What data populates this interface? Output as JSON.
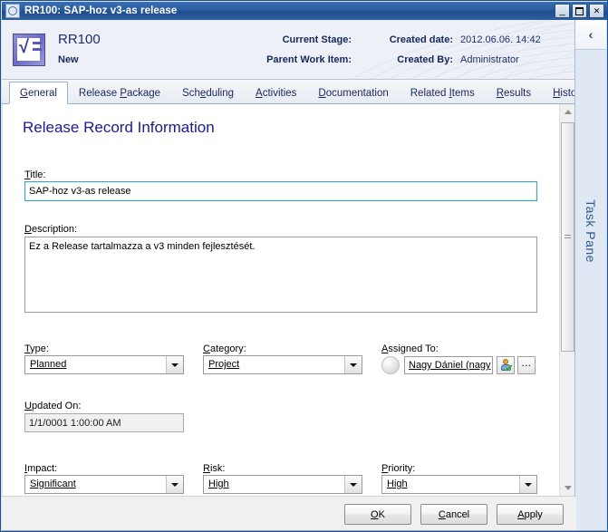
{
  "window": {
    "title": "RR100: SAP-hoz v3-as release",
    "icon": "app-record-icon",
    "controls": {
      "minimize": "_",
      "maximize": "□",
      "close": "✕"
    }
  },
  "header": {
    "record_id": "RR100",
    "state": "New",
    "current_stage_label": "Current Stage:",
    "current_stage_value": "",
    "parent_work_item_label": "Parent Work Item:",
    "parent_work_item_value": "",
    "created_date_label": "Created date:",
    "created_date_value": "2012.06.06. 14:42",
    "created_by_label": "Created By:",
    "created_by_value": "Administrator"
  },
  "tabs": [
    {
      "label": "General",
      "active": true
    },
    {
      "label": "Release Package",
      "active": false
    },
    {
      "label": "Scheduling",
      "active": false
    },
    {
      "label": "Activities",
      "active": false
    },
    {
      "label": "Documentation",
      "active": false
    },
    {
      "label": "Related Items",
      "active": false
    },
    {
      "label": "Results",
      "active": false
    },
    {
      "label": "History",
      "active": false
    }
  ],
  "form": {
    "section_title": "Release Record Information",
    "title_label": "Title:",
    "title_value": "SAP-hoz v3-as release",
    "title_placeholder": "",
    "description_label": "Description:",
    "description_value": "Ez a Release tartalmazza a v3 minden fejlesztését.",
    "description_placeholder": "",
    "type_label": "Type:",
    "type_value": "Planned",
    "category_label": "Category:",
    "category_value": "Project",
    "assigned_to_label": "Assigned To:",
    "assigned_to_value": "Nagy Dániel (nagy",
    "assigned_to_ellipsis": "...",
    "updated_on_label": "Updated On:",
    "updated_on_value": "1/1/0001 1:00:00 AM",
    "impact_label": "Impact:",
    "impact_value": "Significant",
    "risk_label": "Risk:",
    "risk_value": "High",
    "priority_label": "Priority:",
    "priority_value": "High"
  },
  "task_pane": {
    "label": "Task Pane",
    "collapse_glyph": "‹"
  },
  "footer": {
    "ok": "OK",
    "cancel": "Cancel",
    "apply": "Apply"
  },
  "colors": {
    "titlebar": "#2a5d9f",
    "section_title": "#1b1b8f",
    "header_text": "#17275c",
    "focus_border": "#3aa8b8",
    "task_pane_bg": "#dfe8f3"
  }
}
